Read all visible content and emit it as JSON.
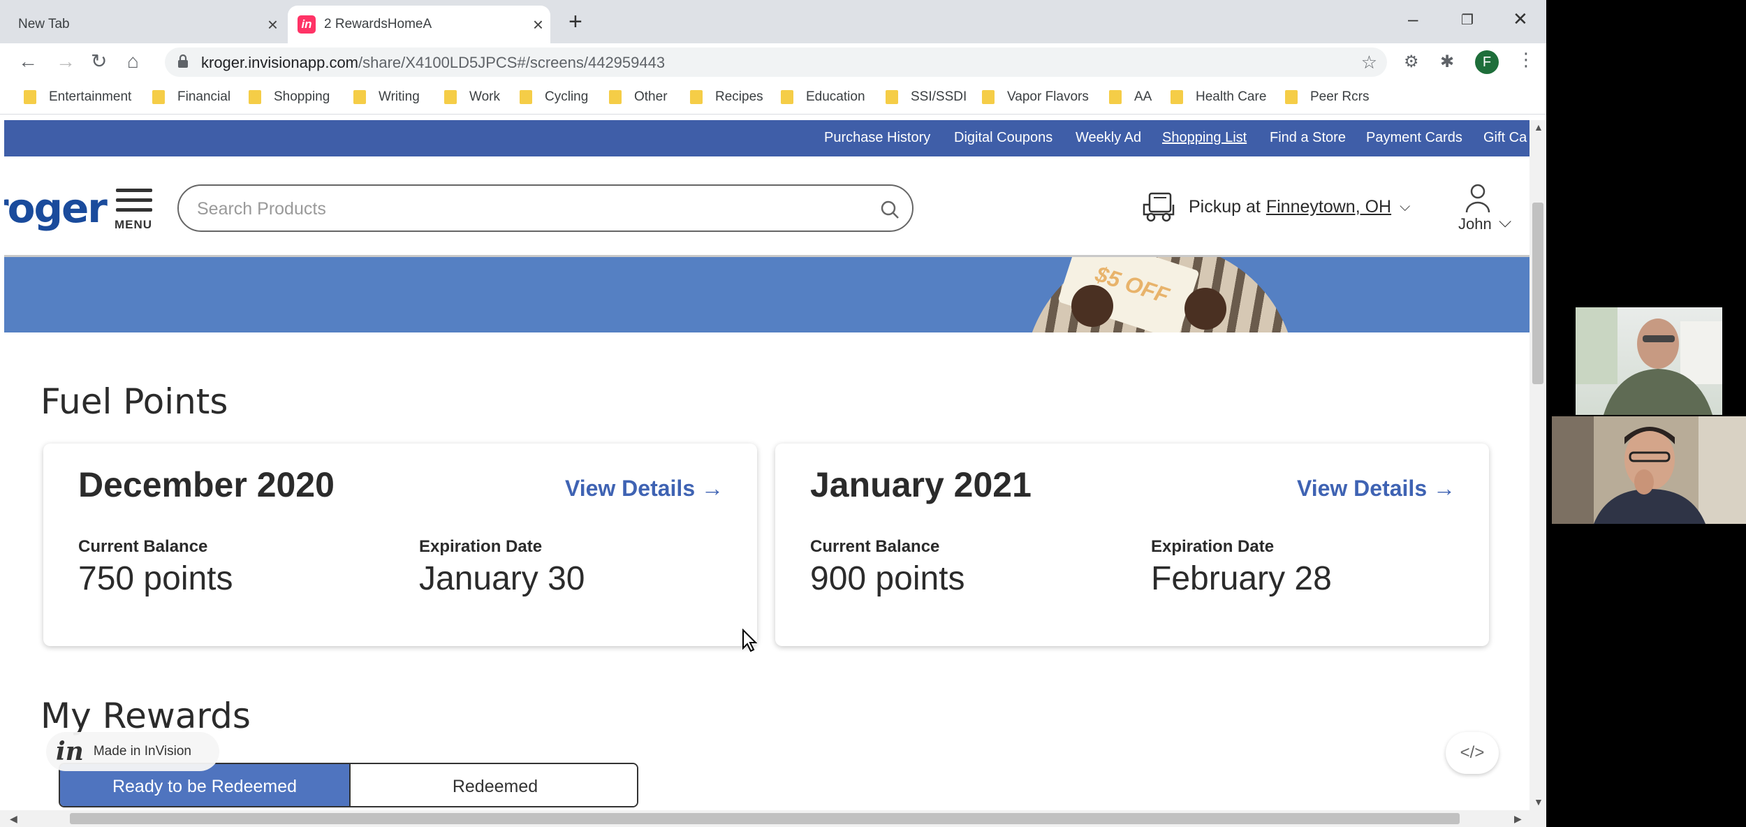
{
  "browser": {
    "tabs": [
      {
        "label": "New Tab"
      },
      {
        "label": "2 RewardsHomeA",
        "favicon": "in"
      }
    ],
    "url_main": "kroger.invisionapp.com",
    "url_path": "/share/X4100LD5JPCS#/screens/442959443",
    "profile_initial": "F",
    "bookmarks": [
      "Entertainment",
      "Financial",
      "Shopping",
      "Writing",
      "Work",
      "Cycling",
      "Other",
      "Recipes",
      "Education",
      "SSI/SSDI",
      "Vapor Flavors",
      "AA",
      "Health Care",
      "Peer Rcrs"
    ]
  },
  "utility_nav": [
    "Purchase History",
    "Digital Coupons",
    "Weekly Ad",
    "Shopping List",
    "Find a Store",
    "Payment Cards",
    "Gift Ca"
  ],
  "header": {
    "logo": "roger",
    "menu_label": "MENU",
    "search_placeholder": "Search Products",
    "pickup_prefix": "Pickup at",
    "pickup_location": "Finneytown, OH",
    "account_name": "John"
  },
  "hero": {
    "coupon_text": "$5 OFF"
  },
  "fuel_points": {
    "title": "Fuel Points",
    "cards": [
      {
        "month": "December 2020",
        "link": "View Details →",
        "balance_label": "Current Balance",
        "balance": "750 points",
        "exp_label": "Expiration Date",
        "exp": "January 30"
      },
      {
        "month": "January 2021",
        "link": "View Details →",
        "balance_label": "Current Balance",
        "balance": "900 points",
        "exp_label": "Expiration Date",
        "exp": "February 28"
      }
    ]
  },
  "rewards": {
    "title": "My Rewards",
    "tabs": [
      "Ready to be Redeemed",
      "Redeemed"
    ]
  },
  "invision_badge": {
    "logo": "in",
    "text": "Made in InVision"
  },
  "code_button": "</>",
  "colors": {
    "util_bar": "#3f5ea8",
    "hero": "#5580c3",
    "link": "#3f63b3",
    "active_tab": "#4f74bf"
  }
}
